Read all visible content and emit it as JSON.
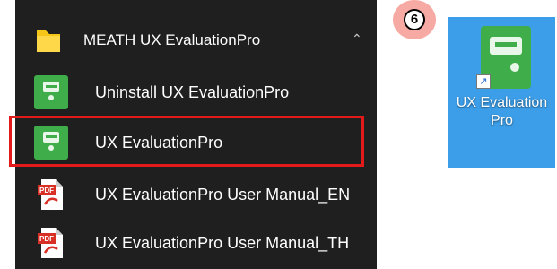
{
  "start_menu": {
    "folder": {
      "label": "MEATH UX EvaluationPro",
      "icon": "folder-icon",
      "expanded": true
    },
    "items": [
      {
        "label": "Uninstall UX EvaluationPro",
        "icon": "app-tile-icon"
      },
      {
        "label": "UX EvaluationPro",
        "icon": "app-tile-icon"
      },
      {
        "label": "UX EvaluationPro User Manual_EN",
        "icon": "pdf-icon"
      },
      {
        "label": "UX EvaluationPro User Manual_TH",
        "icon": "pdf-icon"
      }
    ]
  },
  "step_badge": {
    "text": "6"
  },
  "desktop_shortcut": {
    "caption": "UX EvaluationPro",
    "icon": "app-tile-icon"
  },
  "colors": {
    "menu_bg": "#1f1f1f",
    "app_green": "#3fae4a",
    "highlight_red": "#e21a1a",
    "badge_pink": "#f7a9a3",
    "selection_blue": "#3c9ee8",
    "pdf_red": "#d93025"
  }
}
